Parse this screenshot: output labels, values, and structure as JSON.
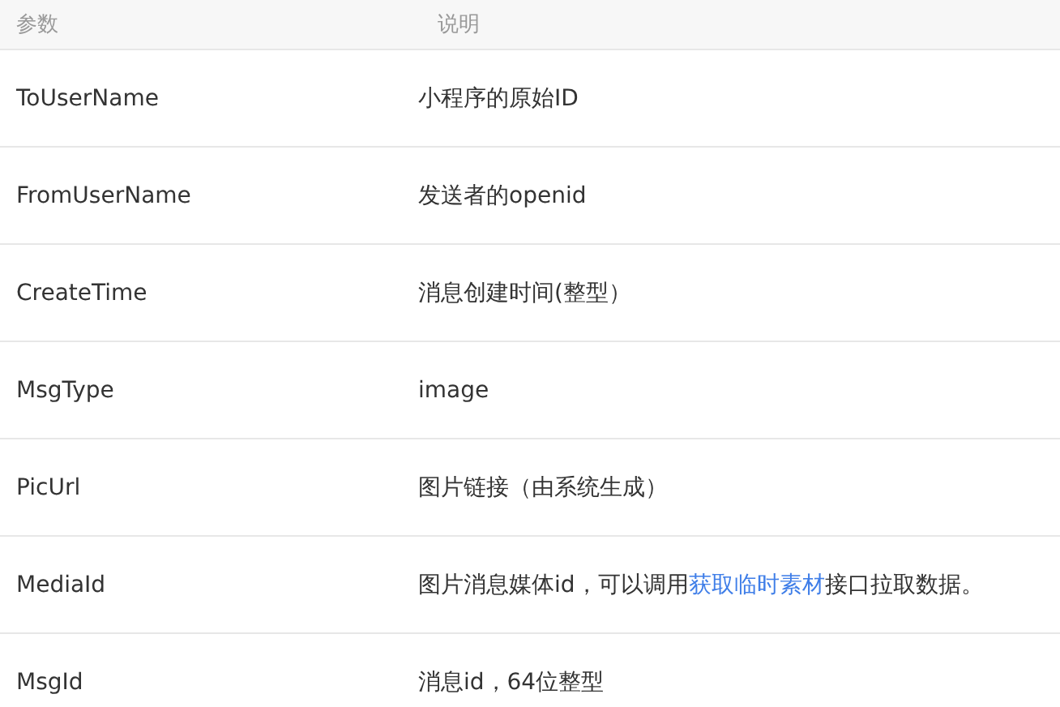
{
  "table": {
    "columns": [
      "参数",
      "说明"
    ],
    "rows": [
      {
        "name": "ToUserName",
        "description": [
          {
            "kind": "text",
            "text": "小程序的原始ID"
          }
        ]
      },
      {
        "name": "FromUserName",
        "description": [
          {
            "kind": "text",
            "text": "发送者的openid"
          }
        ]
      },
      {
        "name": "CreateTime",
        "description": [
          {
            "kind": "text",
            "text": "消息创建时间(整型）"
          }
        ]
      },
      {
        "name": "MsgType",
        "description": [
          {
            "kind": "text",
            "text": "image"
          }
        ]
      },
      {
        "name": "PicUrl",
        "description": [
          {
            "kind": "text",
            "text": "图片链接（由系统生成）"
          }
        ]
      },
      {
        "name": "MediaId",
        "description": [
          {
            "kind": "text",
            "text": "图片消息媒体id，可以调用"
          },
          {
            "kind": "link",
            "text": "获取临时素材"
          },
          {
            "kind": "text",
            "text": "接口拉取数据。"
          }
        ]
      },
      {
        "name": "MsgId",
        "description": [
          {
            "kind": "text",
            "text": "消息id，64位整型"
          }
        ]
      }
    ]
  }
}
